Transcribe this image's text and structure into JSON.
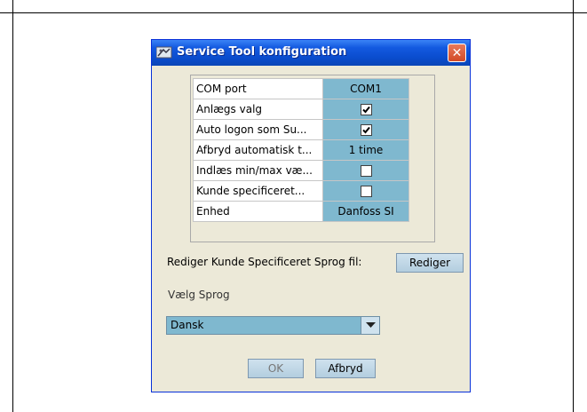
{
  "window": {
    "title": "Service Tool konfiguration",
    "icon": "service-tool-icon",
    "close_icon": "close-icon"
  },
  "properties": [
    {
      "name": "COM port",
      "value": "COM1",
      "type": "text"
    },
    {
      "name": "Anlægs valg",
      "value": "",
      "type": "checkbox",
      "checked": true
    },
    {
      "name": "Auto logon som Su...",
      "value": "",
      "type": "checkbox",
      "checked": true
    },
    {
      "name": "Afbryd automatisk t...",
      "value": "1 time",
      "type": "text"
    },
    {
      "name": "Indlæs min/max væ...",
      "value": "",
      "type": "checkbox",
      "checked": false
    },
    {
      "name": "Kunde specificeret...",
      "value": "",
      "type": "checkbox",
      "checked": false
    },
    {
      "name": "Enhed",
      "value": "Danfoss SI",
      "type": "text"
    }
  ],
  "edit_language_file": {
    "label": "Rediger Kunde Specificeret Sprog fil:",
    "button_label": "Rediger"
  },
  "language": {
    "label": "Vælg Sprog",
    "selected": "Dansk"
  },
  "buttons": {
    "ok_label": "OK",
    "cancel_label": "Afbryd"
  },
  "colors": {
    "title_bar": "#0a4ccd",
    "value_cell": "#7fb8cf",
    "dialog_bg": "#ece9d8",
    "close_button": "#d24a26"
  }
}
